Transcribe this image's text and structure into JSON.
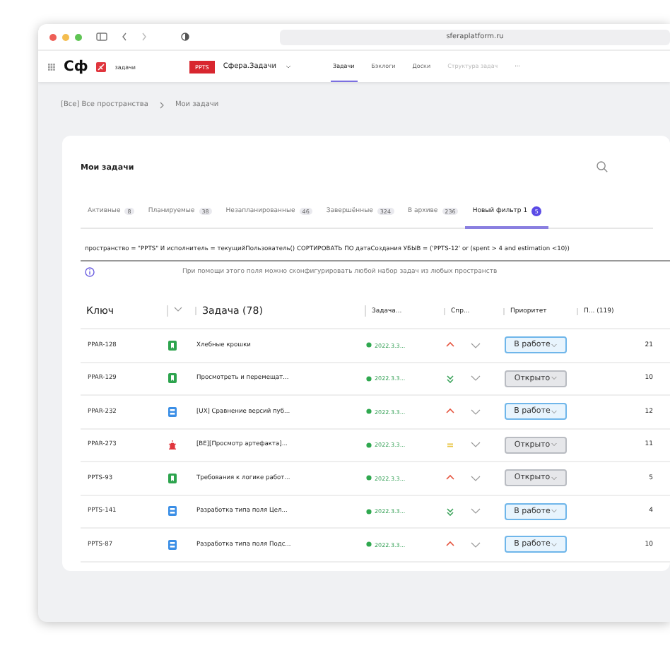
{
  "browser": {
    "address": "sferaplatform.ru"
  },
  "app": {
    "logo": "Сф",
    "product": "задачи",
    "project_badge": "PPTS",
    "project_name": "Сфера.Задачи",
    "nav": [
      {
        "label": "Задачи",
        "selected": true,
        "disabled": false
      },
      {
        "label": "Бэклоги",
        "selected": false,
        "disabled": false
      },
      {
        "label": "Доски",
        "selected": false,
        "disabled": false
      },
      {
        "label": "Структура задач",
        "selected": false,
        "disabled": true
      },
      {
        "label": "···",
        "selected": false,
        "disabled": false
      }
    ]
  },
  "breadcrumb": [
    "[Все] Все пространства",
    "Мои задачи"
  ],
  "card": {
    "title": "Мои задачи",
    "tabs": [
      {
        "label": "Активные",
        "count": "8",
        "selected": false
      },
      {
        "label": "Планируемые",
        "count": "38",
        "selected": false
      },
      {
        "label": "Незапланированные",
        "count": "46",
        "selected": false
      },
      {
        "label": "Завершённые",
        "count": "324",
        "selected": false
      },
      {
        "label": "В архиве",
        "count": "236",
        "selected": false
      },
      {
        "label": "Новый фильтр 1",
        "count": "5",
        "selected": true
      }
    ],
    "query": "пространство = \"PPTS\" И исполнитель = текущийПользователь() СОРТИРОВАТЬ ПО датаСоздания УБЫВ  = ('PPTS-12' or (spent > 4 and estimation <10))",
    "hint": "При помощи этого поля можно сконфигурировать любой набор задач из любых пространств",
    "table": {
      "columns": [
        "Ключ",
        "Задача (78)",
        "Задача...",
        "Спр...",
        "Приоритет",
        "П... (119)"
      ],
      "rows": [
        {
          "key": "PPAR-128",
          "type_icon": {
            "kind": "story"
          },
          "task": "Хлебные крошки",
          "date": "2022.3.3...",
          "priority_icon": {
            "kind": "high"
          },
          "status": {
            "label": "В работе",
            "kind": "in_progress"
          },
          "column_6": "21"
        },
        {
          "key": "PPAR-129",
          "type_icon": {
            "kind": "story"
          },
          "task": "Просмотреть и перемещат...",
          "date": "2022.3.3...",
          "priority_icon": {
            "kind": "lowest"
          },
          "status": {
            "label": "Открыто",
            "kind": "open"
          },
          "column_6": "10"
        },
        {
          "key": "PPAR-232",
          "type_icon": {
            "kind": "task"
          },
          "task": "[UX] Сравнение версий пуб...",
          "date": "2022.3.3...",
          "priority_icon": {
            "kind": "high"
          },
          "status": {
            "label": "В работе",
            "kind": "in_progress"
          },
          "column_6": "12"
        },
        {
          "key": "PPAR-273",
          "type_icon": {
            "kind": "bug"
          },
          "task": "[BE][Просмотр артефакта]...",
          "date": "2022.3.3...",
          "priority_icon": {
            "kind": "medium"
          },
          "status": {
            "label": "Открыто",
            "kind": "open"
          },
          "column_6": "11"
        },
        {
          "key": "PPTS-93",
          "type_icon": {
            "kind": "story"
          },
          "task": "Требования к логике работ...",
          "date": "2022.3.3...",
          "priority_icon": {
            "kind": "high"
          },
          "status": {
            "label": "Открыто",
            "kind": "open"
          },
          "column_6": "5"
        },
        {
          "key": "PPTS-141",
          "type_icon": {
            "kind": "task"
          },
          "task": "Разработка типа поля Цел...",
          "date": "2022.3.3...",
          "priority_icon": {
            "kind": "lowest"
          },
          "status": {
            "label": "В работе",
            "kind": "in_progress"
          },
          "column_6": "4"
        },
        {
          "key": "PPTS-87",
          "type_icon": {
            "kind": "task"
          },
          "task": "Разработка типа поля Подс...",
          "date": "2022.3.3...",
          "priority_icon": {
            "kind": "high"
          },
          "status": {
            "label": "В работе",
            "kind": "in_progress"
          },
          "column_6": "10"
        }
      ]
    }
  }
}
